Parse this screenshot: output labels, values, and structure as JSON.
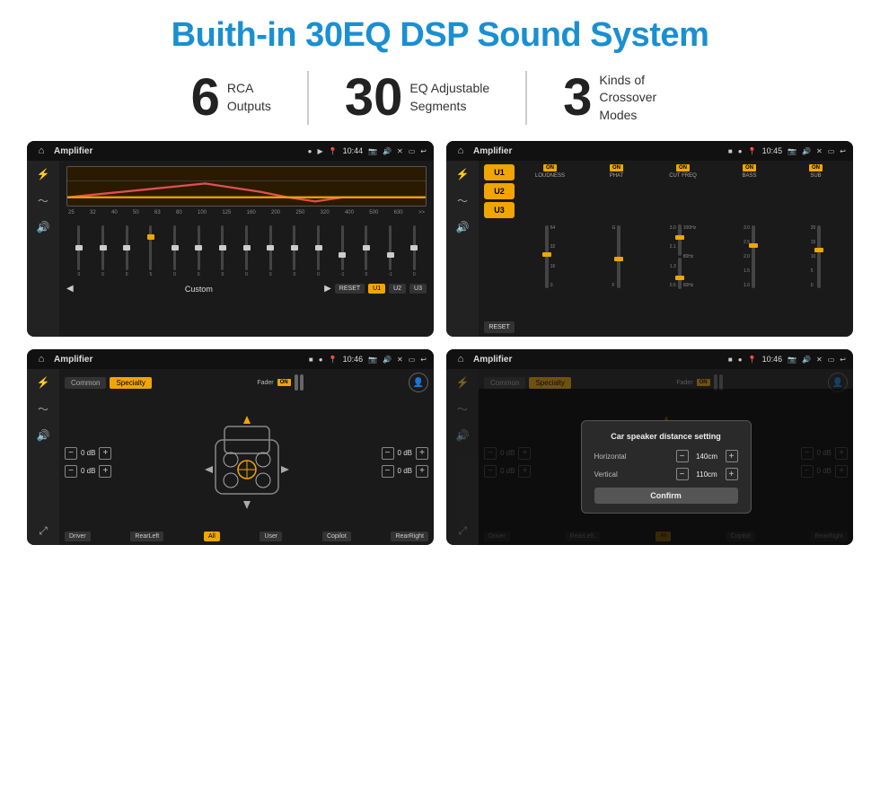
{
  "title": "Buith-in 30EQ DSP Sound System",
  "stats": [
    {
      "number": "6",
      "desc_line1": "RCA",
      "desc_line2": "Outputs"
    },
    {
      "number": "30",
      "desc_line1": "EQ Adjustable",
      "desc_line2": "Segments"
    },
    {
      "number": "3",
      "desc_line1": "Kinds of",
      "desc_line2": "Crossover Modes"
    }
  ],
  "screens": [
    {
      "id": "eq-screen",
      "status_title": "Amplifier",
      "time": "10:44",
      "type": "eq"
    },
    {
      "id": "crossover-screen",
      "status_title": "Amplifier",
      "time": "10:45",
      "type": "crossover"
    },
    {
      "id": "common-screen",
      "status_title": "Amplifier",
      "time": "10:46",
      "type": "common"
    },
    {
      "id": "dialog-screen",
      "status_title": "Amplifier",
      "time": "10:46",
      "type": "dialog"
    }
  ],
  "eq": {
    "bands": [
      "25",
      "32",
      "40",
      "50",
      "63",
      "80",
      "100",
      "125",
      "160",
      "200",
      "250",
      "320",
      "400",
      "500",
      "630"
    ],
    "values": [
      "0",
      "0",
      "0",
      "5",
      "0",
      "0",
      "0",
      "0",
      "0",
      "0",
      "0",
      "-1",
      "0",
      "-1"
    ],
    "preset": "Custom",
    "buttons": [
      "RESET",
      "U1",
      "U2",
      "U3"
    ]
  },
  "crossover": {
    "presets": [
      "U1",
      "U2",
      "U3"
    ],
    "channels": [
      "LOUDNESS",
      "PHAT",
      "CUT FREQ",
      "BASS",
      "SUB"
    ],
    "on_labels": [
      "ON",
      "ON",
      "ON",
      "ON",
      "ON"
    ],
    "reset": "RESET"
  },
  "common": {
    "tabs": [
      "Common",
      "Specialty"
    ],
    "fader_label": "Fader",
    "fader_on": "ON",
    "volumes": [
      "0 dB",
      "0 dB",
      "0 dB",
      "0 dB"
    ],
    "bottom_btns": [
      "Driver",
      "RearLeft",
      "All",
      "User",
      "Copilot",
      "RearRight"
    ]
  },
  "dialog": {
    "title": "Car speaker distance setting",
    "horizontal_label": "Horizontal",
    "horizontal_value": "140cm",
    "vertical_label": "Vertical",
    "vertical_value": "110cm",
    "confirm_label": "Confirm",
    "tabs": [
      "Common",
      "Specialty"
    ],
    "fader_on": "ON",
    "right_db1": "0 dB",
    "right_db2": "0 dB",
    "bottom_btns": [
      "Driver",
      "RearLeft.",
      "Copilot",
      "RearRight"
    ]
  }
}
